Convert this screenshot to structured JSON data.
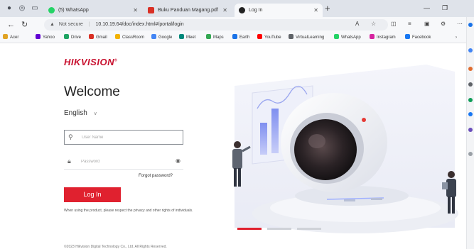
{
  "browser": {
    "tabs": [
      {
        "title": "(5) WhatsApp",
        "active": false
      },
      {
        "title": "Buku Panduan Magang.pdf",
        "active": false
      },
      {
        "title": "Log In",
        "active": true
      }
    ],
    "not_secure": "Not secure",
    "url": "10.10.19.64/doc/index.html#/portal/login",
    "bookmarks": [
      {
        "label": "Acer",
        "color": "#e0a324"
      },
      {
        "label": "Yahoo",
        "color": "#6001d2"
      },
      {
        "label": "Drive",
        "color": "#1fa463"
      },
      {
        "label": "Gmail",
        "color": "#d93025"
      },
      {
        "label": "ClassRoom",
        "color": "#f2b203"
      },
      {
        "label": "Google",
        "color": "#4285f4"
      },
      {
        "label": "Meet",
        "color": "#00897b"
      },
      {
        "label": "Maps",
        "color": "#34a853"
      },
      {
        "label": "Earth",
        "color": "#1a73e8"
      },
      {
        "label": "YouTube",
        "color": "#ff0000"
      },
      {
        "label": "VirtualLearning",
        "color": "#5f6368"
      },
      {
        "label": "WhatsApp",
        "color": "#25d366"
      },
      {
        "label": "Instagram",
        "color": "#d6249f"
      },
      {
        "label": "Facebook",
        "color": "#1877f2"
      }
    ]
  },
  "login": {
    "brand": "HIKVISION",
    "trademark": "®",
    "welcome": "Welcome",
    "language": "English",
    "username_placeholder": "User Name",
    "password_placeholder": "Password",
    "forgot": "Forgot password?",
    "login_button": "Log In",
    "privacy": "When using the product, please respect the privacy and other rights of individuals.",
    "copyright": "©2023 Hikvision Digital Technology Co., Ltd. All Rights Reserved."
  },
  "colors": {
    "brand_red": "#c8102e",
    "button_red": "#e0212f"
  }
}
